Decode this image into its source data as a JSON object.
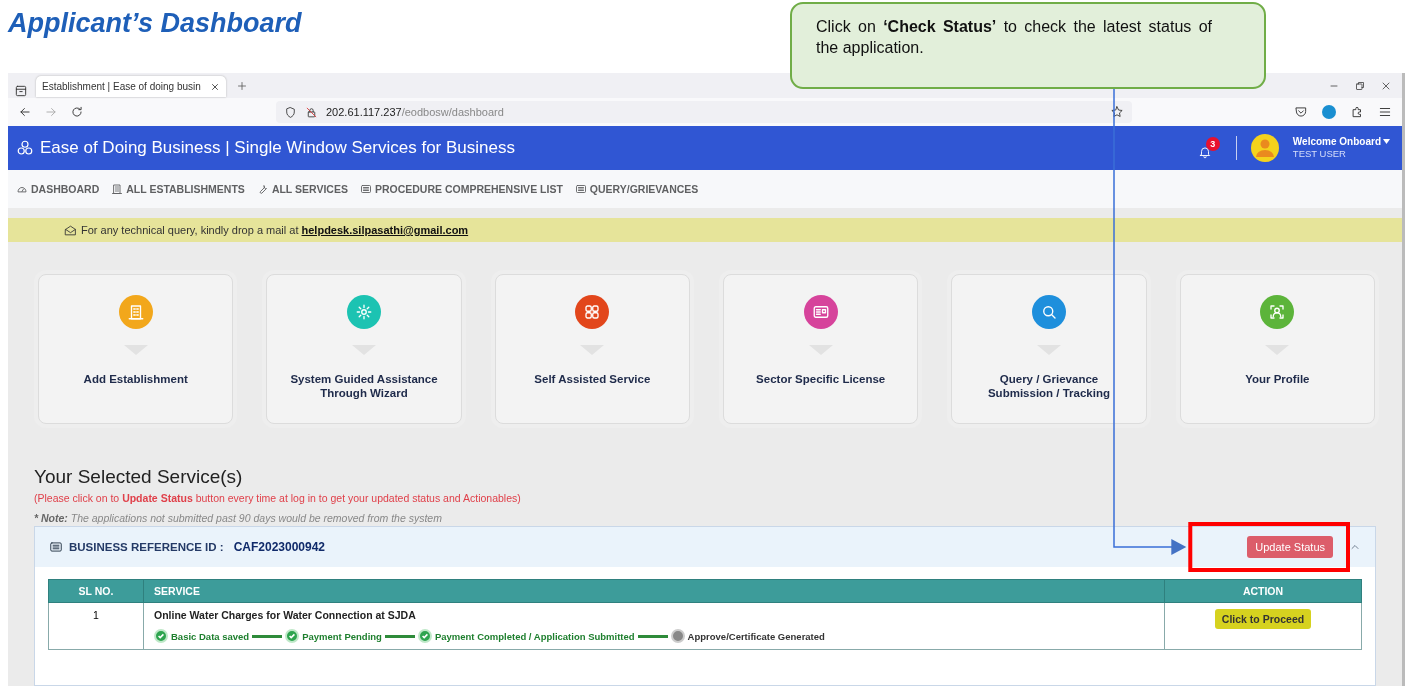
{
  "page_title": "Applicant’s Dashboard",
  "callout": {
    "text": "Click on **‘Check Status’** to check the latest status of the application."
  },
  "browser": {
    "tab_title": "Establishment | Ease of doing busin",
    "url_host": "202.61.117.237",
    "url_path": "/eodbosw/dashboard"
  },
  "app_header": {
    "title": "Ease of Doing Business | Single Window Services for Business",
    "notification_count": "3",
    "welcome": "Welcome Onboard",
    "user": "TEST USER"
  },
  "nav": [
    {
      "label": "DASHBOARD",
      "kind": "gauge"
    },
    {
      "label": "ALL ESTABLISHMENTS",
      "kind": "building"
    },
    {
      "label": "ALL SERVICES",
      "kind": "wrench"
    },
    {
      "label": "PROCEDURE COMPREHENSIVE LIST",
      "kind": "list"
    },
    {
      "label": "QUERY/GRIEVANCES",
      "kind": "list"
    }
  ],
  "banner": {
    "text": "For any technical query, kindly drop a mail at",
    "link": "helpdesk.silpasathi@gmail.com"
  },
  "cards": [
    {
      "label": "Add Establishment",
      "kind": "building",
      "color": "#f2a71b"
    },
    {
      "label": "System Guided Assistance Through Wizard",
      "kind": "gear",
      "color": "#1cc3b2"
    },
    {
      "label": "Self Assisted Service",
      "kind": "grid",
      "color": "#e2461b"
    },
    {
      "label": "Sector Specific License",
      "kind": "license",
      "color": "#d6439b"
    },
    {
      "label": "Query / Grievance Submission / Tracking",
      "kind": "search",
      "color": "#1e8fdc"
    },
    {
      "label": "Your Profile",
      "kind": "profile",
      "color": "#5cb43a"
    }
  ],
  "section_title": "Your Selected Service(s)",
  "instruction": "(Please click on to **Update Status** button every time at log in to get your updated status and Actionables)",
  "note": {
    "label": "* Note:",
    "text": "The applications not submitted past 90 days would be removed from the system"
  },
  "panel": {
    "reference_label": "BUSINESS REFERENCE ID :",
    "reference_id": "CAF2023000942",
    "update_button": "Update Status",
    "expanded": true
  },
  "table": {
    "columns": [
      "SL NO.",
      "SERVICE",
      "ACTION"
    ],
    "rows": [
      {
        "sl_no": "1",
        "service": "Online Water Charges for Water Connection at SJDA",
        "action": "Click to Proceed",
        "steps": [
          {
            "label": "Basic Data saved",
            "done": true
          },
          {
            "label": "Payment Pending",
            "done": true
          },
          {
            "label": "Payment Completed / Application Submitted",
            "done": true
          },
          {
            "label": "Approve/Certificate Generated",
            "done": false
          }
        ]
      }
    ]
  }
}
